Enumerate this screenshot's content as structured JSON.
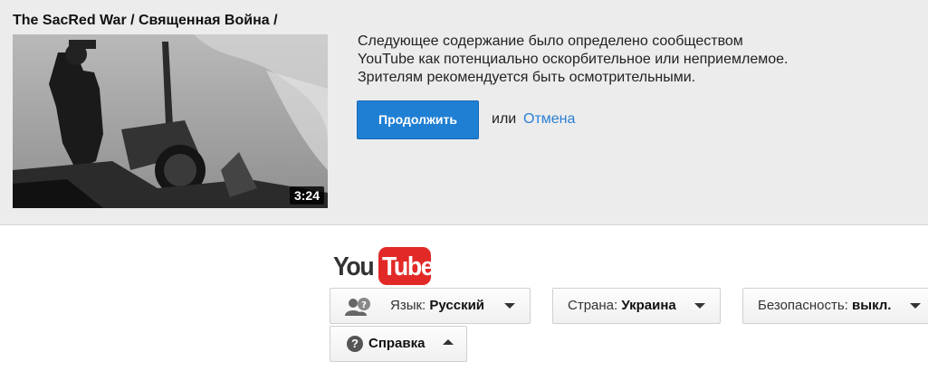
{
  "video": {
    "title": "The SacRed War / Священная Война /",
    "duration": "3:24"
  },
  "warning": {
    "line1": "Следующее содержание было определено сообществом",
    "line2": "YouTube как потенциально оскорбительное или неприемлемое.",
    "line3": "Зрителям рекомендуется быть осмотрительными.",
    "continue_label": "Продолжить",
    "or_text": "или",
    "cancel_label": "Отмена"
  },
  "logo": {
    "you": "You",
    "tube": "Tube"
  },
  "footer": {
    "language": {
      "label": "Язык:",
      "value": "Русский",
      "icon": "users-icon"
    },
    "country": {
      "label": "Страна:",
      "value": "Украина"
    },
    "safety": {
      "label": "Безопасность:",
      "value": "выкл."
    },
    "help": {
      "label": "Справка",
      "icon": "question-icon"
    }
  },
  "colors": {
    "accent": "#1f7fd3",
    "link": "#2a7fd4",
    "logo_red": "#e12a27"
  }
}
